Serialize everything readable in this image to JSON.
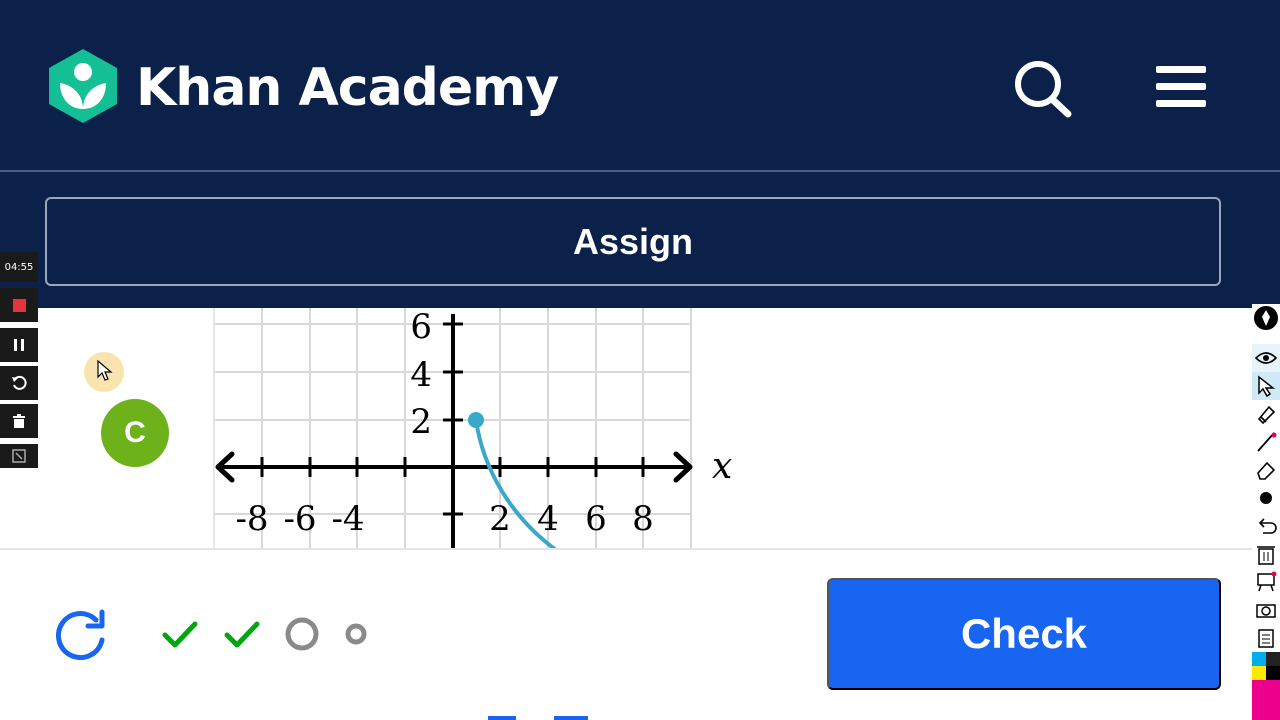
{
  "header": {
    "brand": "Khan Academy",
    "logo_icon": "khan-academy-logo",
    "search_icon": "search-icon",
    "menu_icon": "hamburger-menu-icon",
    "assign_label": "Assign",
    "bg_color": "#0b2149"
  },
  "recorder": {
    "time": "04:55",
    "buttons": [
      "stop-icon",
      "pause-icon",
      "undo-icon",
      "trash-icon",
      "expand-icon"
    ]
  },
  "graph": {
    "x_label": "x",
    "x_ticks": [
      "-8",
      "-6",
      "-4",
      "2",
      "4",
      "6",
      "8"
    ],
    "y_ticks": [
      "6",
      "4",
      "2"
    ],
    "curve_color": "#3aa9c9",
    "start_point": [
      1,
      2
    ]
  },
  "avatar": {
    "letter": "C",
    "color": "#6db21a"
  },
  "toolbar": {
    "tools": [
      "pen-icon",
      "eye-icon",
      "pointer-icon",
      "highlighter-icon",
      "line-icon",
      "eraser-icon",
      "dot-icon",
      "undo-icon",
      "trash-icon",
      "board-icon",
      "camera-icon",
      "notes-icon",
      "colors-icon"
    ]
  },
  "progress": {
    "items": [
      "correct",
      "correct",
      "current",
      "pending"
    ]
  },
  "footer": {
    "check_label": "Check",
    "refresh_icon": "refresh-icon",
    "accent_color": "#1865f2"
  }
}
